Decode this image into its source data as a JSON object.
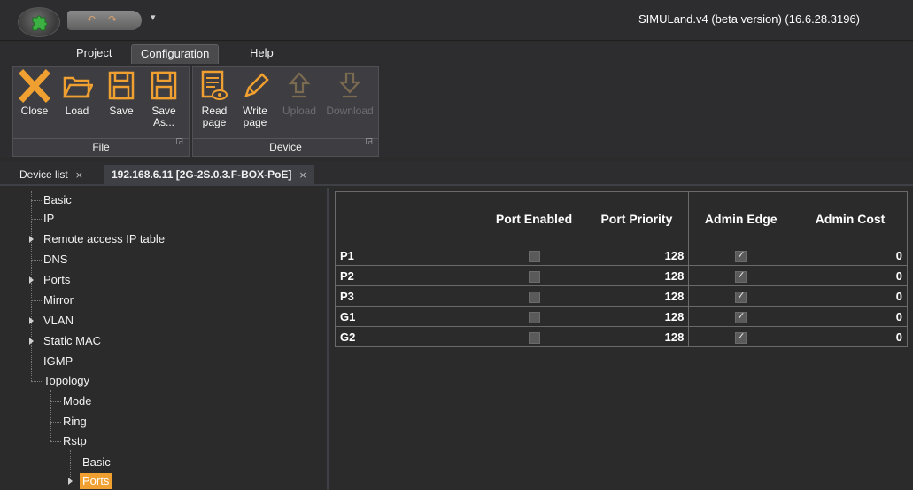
{
  "window": {
    "title": "SIMULand.v4 (beta version) (16.6.28.3196)",
    "quick_access_icons": [
      "undo-icon",
      "redo-icon"
    ],
    "qat_dropdown_glyph": "▾"
  },
  "ribbon_tabs": [
    {
      "label": "Project",
      "active": false
    },
    {
      "label": "Configuration",
      "active": true
    },
    {
      "label": "Help",
      "active": false
    }
  ],
  "ribbon": {
    "file_group": {
      "label": "File",
      "buttons": [
        {
          "label": "Close",
          "icon": "close-icon"
        },
        {
          "label": "Load",
          "icon": "folder-open-icon"
        },
        {
          "label": "Save",
          "icon": "save-icon"
        },
        {
          "label_line1": "Save",
          "label_line2": "As...",
          "icon": "save-as-icon"
        }
      ]
    },
    "device_group": {
      "label": "Device",
      "buttons": [
        {
          "label_line1": "Read",
          "label_line2": "page",
          "icon": "read-page-icon",
          "enabled": true
        },
        {
          "label_line1": "Write",
          "label_line2": "page",
          "icon": "pencil-icon",
          "enabled": true
        },
        {
          "label": "Upload",
          "icon": "upload-arrow-icon",
          "enabled": false
        },
        {
          "label": "Download",
          "icon": "download-arrow-icon",
          "enabled": false
        }
      ]
    },
    "accent_color": "#f0a030"
  },
  "doc_tabs": [
    {
      "label": "Device list",
      "close": "×",
      "active": false
    },
    {
      "label": "192.168.6.11 [2G-2S.0.3.F-BOX-PoE]",
      "close": "×",
      "active": true
    }
  ],
  "tree": {
    "items": [
      {
        "label": "Basic",
        "expandable": false
      },
      {
        "label": "IP",
        "expandable": false
      },
      {
        "label": "Remote access IP table",
        "expandable": true
      },
      {
        "label": "DNS",
        "expandable": false
      },
      {
        "label": "Ports",
        "expandable": true
      },
      {
        "label": "Mirror",
        "expandable": false
      },
      {
        "label": "VLAN",
        "expandable": true
      },
      {
        "label": "Static MAC",
        "expandable": true
      },
      {
        "label": "IGMP",
        "expandable": false
      },
      {
        "label": "Topology",
        "expandable": false,
        "expanded": true
      },
      {
        "label": "Mode",
        "expandable": false
      },
      {
        "label": "Ring",
        "expandable": false
      },
      {
        "label": "Rstp",
        "expandable": false,
        "expanded": true
      },
      {
        "label": "Basic",
        "expandable": false
      },
      {
        "label": "Ports",
        "expandable": true,
        "selected": true
      }
    ]
  },
  "grid": {
    "columns": [
      "",
      "Port Enabled",
      "Port Priority",
      "Admin Edge",
      "Admin Cost"
    ],
    "rows": [
      {
        "port": "P1",
        "port_enabled": false,
        "port_priority": "128",
        "admin_edge": true,
        "admin_cost": "0"
      },
      {
        "port": "P2",
        "port_enabled": false,
        "port_priority": "128",
        "admin_edge": true,
        "admin_cost": "0"
      },
      {
        "port": "P3",
        "port_enabled": false,
        "port_priority": "128",
        "admin_edge": true,
        "admin_cost": "0"
      },
      {
        "port": "G1",
        "port_enabled": false,
        "port_priority": "128",
        "admin_edge": true,
        "admin_cost": "0"
      },
      {
        "port": "G2",
        "port_enabled": false,
        "port_priority": "128",
        "admin_edge": true,
        "admin_cost": "0"
      }
    ]
  }
}
